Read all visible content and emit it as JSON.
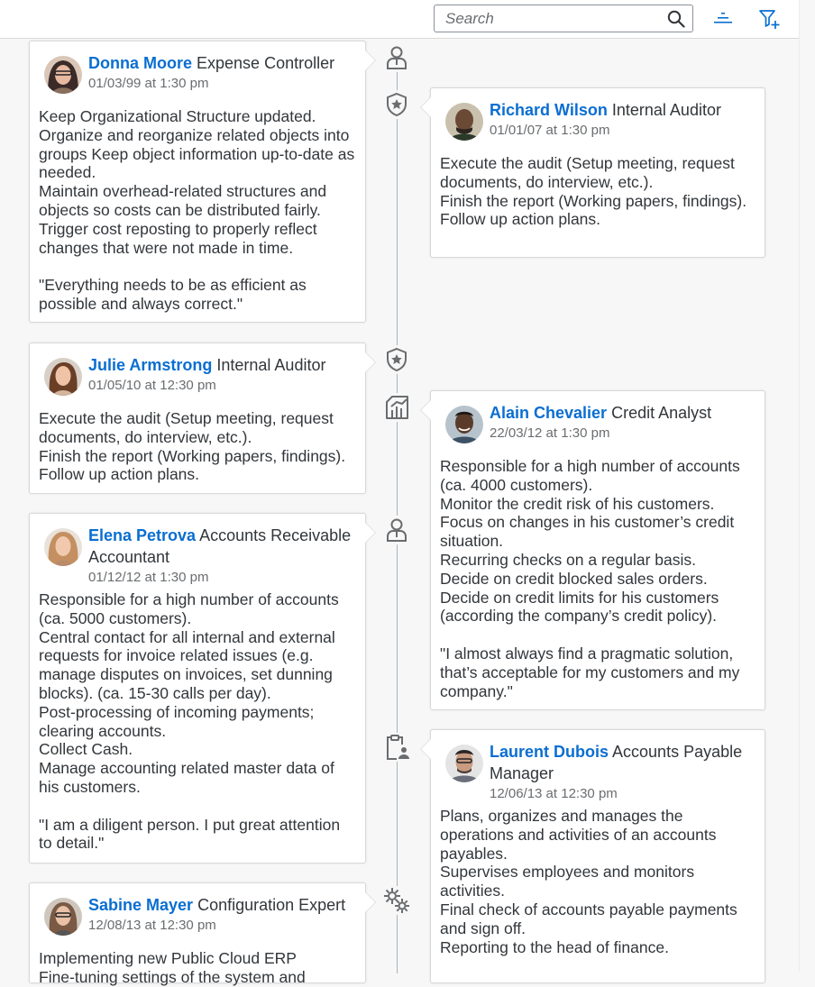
{
  "toolbar": {
    "search_placeholder": "Search",
    "search_icon": "search-icon",
    "sort_icon": "sort-icon",
    "filter_icon": "filter-add-icon"
  },
  "colors": {
    "link": "#0a6ed1",
    "text": "#32363a",
    "muted": "#6a6d70",
    "timeline": "#a9b4be",
    "icon": "#6a6d70",
    "toolbar_icon": "#0a6ed1"
  },
  "timeline": [
    {
      "icon": "person-placeholder-icon",
      "name": "Donna Moore",
      "role": "Expense Controller",
      "date": "01/03/99 at 1:30 pm",
      "text": "Keep Organizational Structure updated.\nOrganize and reorganize related objects into groups Keep object information up-to-date as needed.\nMaintain overhead-related structures and objects so costs can be distributed fairly.\nTrigger cost reposting to properly reflect changes that were not made in time.\n\n\"Everything needs to be as efficient as possible and always correct.\""
    },
    {
      "icon": "shield-star-icon",
      "name": "Richard Wilson",
      "role": "Internal Auditor",
      "date": "01/01/07 at 1:30 pm",
      "text": "Execute the audit (Setup meeting, request documents, do interview, etc.).\nFinish the report (Working papers, findings).\nFollow up action plans."
    },
    {
      "icon": "shield-star-icon",
      "name": "Julie Armstrong",
      "role": "Internal Auditor",
      "date": "01/05/10 at 12:30 pm",
      "text": "Execute the audit (Setup meeting, request documents, do interview, etc.).\nFinish the report (Working papers, findings).\nFollow up action plans."
    },
    {
      "icon": "business-chart-icon",
      "name": "Alain Chevalier",
      "role": "Credit Analyst",
      "date": "22/03/12 at 1:30 pm",
      "text": "Responsible for a high number of accounts (ca. 4000 customers).\nMonitor the credit risk of his customers.\nFocus on changes in his customer’s credit situation.\nRecurring checks on a regular basis.\nDecide on credit blocked sales orders.\nDecide on credit limits for his customers (according the company’s credit policy).\n\n\"I almost always find a pragmatic solution, that’s acceptable for my customers and my company.\""
    },
    {
      "icon": "person-placeholder-icon",
      "name": "Elena Petrova",
      "role": "Accounts Receivable Accountant",
      "date": "01/12/12 at 1:30 pm",
      "text": "Responsible for a high number of accounts (ca. 5000 customers).\nCentral contact for all internal and external requests for invoice related issues (e.g. manage disputes on invoices, set dunning blocks). (ca. 15-30 calls per day).\nPost-processing of incoming payments; clearing accounts.\nCollect Cash.\nManage accounting related master data of his customers.\n\n\"I am a diligent person. I put great attention to detail.\""
    },
    {
      "icon": "clipboard-person-icon",
      "name": "Laurent Dubois",
      "role": "Accounts Payable Manager",
      "date": "12/06/13 at 12:30 pm",
      "text": "Plans, organizes and manages the operations and activities of an accounts payables.\nSupervises employees and monitors activities.\nFinal check of accounts payable payments and sign off.\nReporting to the head of finance."
    },
    {
      "icon": "gears-icon",
      "name": "Sabine Mayer",
      "role": "Configuration Expert",
      "date": "12/08/13 at 12:30 pm",
      "text": "Implementing new Public Cloud ERP\nFine-tuning settings of the system and"
    }
  ]
}
